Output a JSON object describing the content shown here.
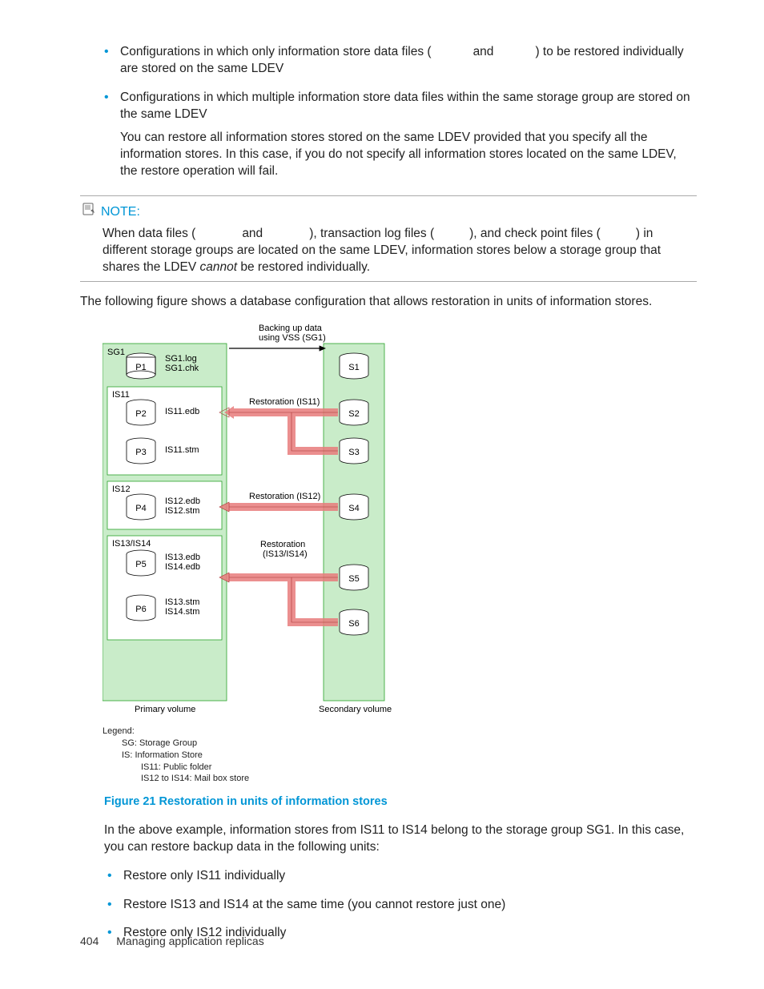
{
  "bullets_top": [
    {
      "pre": "Configurations in which only information store data files (",
      "mid": "and",
      "post": ") to be restored individually are stored on the same LDEV"
    },
    {
      "line1_pre": "Configurations in which multiple information store data files within the same storage group are stored on the same LDEV",
      "extra": "You can restore all information stores stored on the same LDEV provided that you specify all the information stores. In this case, if you do not specify all information stores located on the same LDEV, the restore operation will fail."
    }
  ],
  "note": {
    "label": "NOTE:",
    "body_pre": "When data files (",
    "body_and1": "and",
    "body_mid1": "), transaction log files (",
    "body_mid2": "), and check point files (",
    "body_mid3": ")",
    "body_line2a": "in different storage groups are located on the same LDEV, information stores below a storage group that shares the LDEV ",
    "cannot": "cannot",
    "body_line2b": " be restored individually."
  },
  "para_after_note": "The following figure shows a database configuration that allows restoration in units of information stores.",
  "figure": {
    "caption": "Figure 21 Restoration in units of information stores",
    "top_label_l1": "Backing up data",
    "top_label_l2": "using VSS (SG1)",
    "sg_label": "SG1",
    "sg1_log": "SG1.log",
    "sg1_chk": "SG1.chk",
    "primary_label": "Primary volume",
    "secondary_label": "Secondary volume",
    "groups": {
      "is11": {
        "name": "IS11",
        "disks": [
          {
            "d": "P2",
            "f": "IS11.edb"
          },
          {
            "d": "P3",
            "f": "IS11.stm"
          }
        ],
        "restore": "Restoration (IS11)"
      },
      "is12": {
        "name": "IS12",
        "disks": [
          {
            "d": "P4",
            "f": "IS12.edb",
            "f2": "IS12.stm"
          }
        ],
        "restore": "Restoration (IS12)"
      },
      "is1314": {
        "name": "IS13/IS14",
        "disks": [
          {
            "d": "P5",
            "f": "IS13.edb",
            "f2": "IS14.edb"
          },
          {
            "d": "P6",
            "f": "IS13.stm",
            "f2": "IS14.stm"
          }
        ],
        "restore_l1": "Restoration",
        "restore_l2": "(IS13/IS14)"
      }
    },
    "p1": "P1",
    "s_disks": [
      "S1",
      "S2",
      "S3",
      "S4",
      "S5",
      "S6"
    ],
    "legend_title": "Legend:",
    "legend_sg": "SG: Storage Group",
    "legend_is": "IS: Information Store",
    "legend_is11": "IS11: Public folder",
    "legend_is12_14": "IS12 to IS14: Mail box store"
  },
  "para_after_fig": "In the above example, information stores from IS11 to IS14 belong to the storage group SG1. In this case, you can restore backup data in the following units:",
  "bullets_bottom": [
    "Restore only IS11 individually",
    "Restore IS13 and IS14 at the same time (you cannot restore just one)",
    "Restore only IS12 individually"
  ],
  "footer": {
    "page": "404",
    "title": "Managing application replicas"
  }
}
